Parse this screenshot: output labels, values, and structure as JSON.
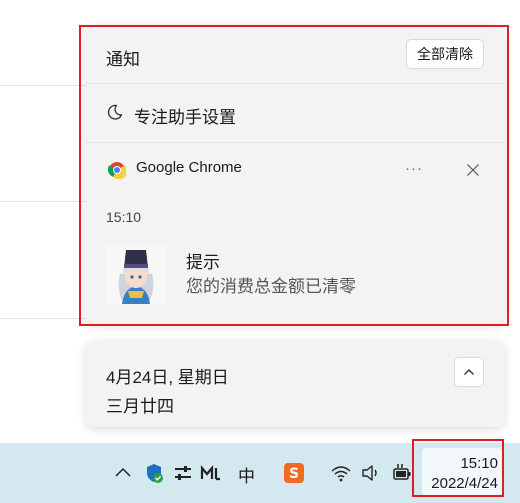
{
  "notification_center": {
    "title": "通知",
    "clear_all_label": "全部清除",
    "focus_assist_label": "专注助手设置",
    "app_name": "Google Chrome",
    "more_label": "···",
    "notification": {
      "time": "15:10",
      "title": "提示",
      "body": "您的消费总金额已清零"
    }
  },
  "calendar": {
    "date": "4月24日, 星期日",
    "lunar": "三月廿四"
  },
  "taskbar": {
    "ime_label": "中",
    "clock_time": "15:10",
    "clock_date": "2022/4/24"
  },
  "colors": {
    "taskbar": "#d4e8ef",
    "flyout": "#f3f3f3",
    "highlight": "#e01d25"
  },
  "icons": [
    "moon-icon",
    "chrome-icon",
    "close-icon",
    "chevron-up-icon",
    "shield-icon",
    "sliders-icon",
    "keyboard-icon",
    "sogou-icon",
    "wifi-icon",
    "speaker-icon",
    "battery-icon"
  ]
}
